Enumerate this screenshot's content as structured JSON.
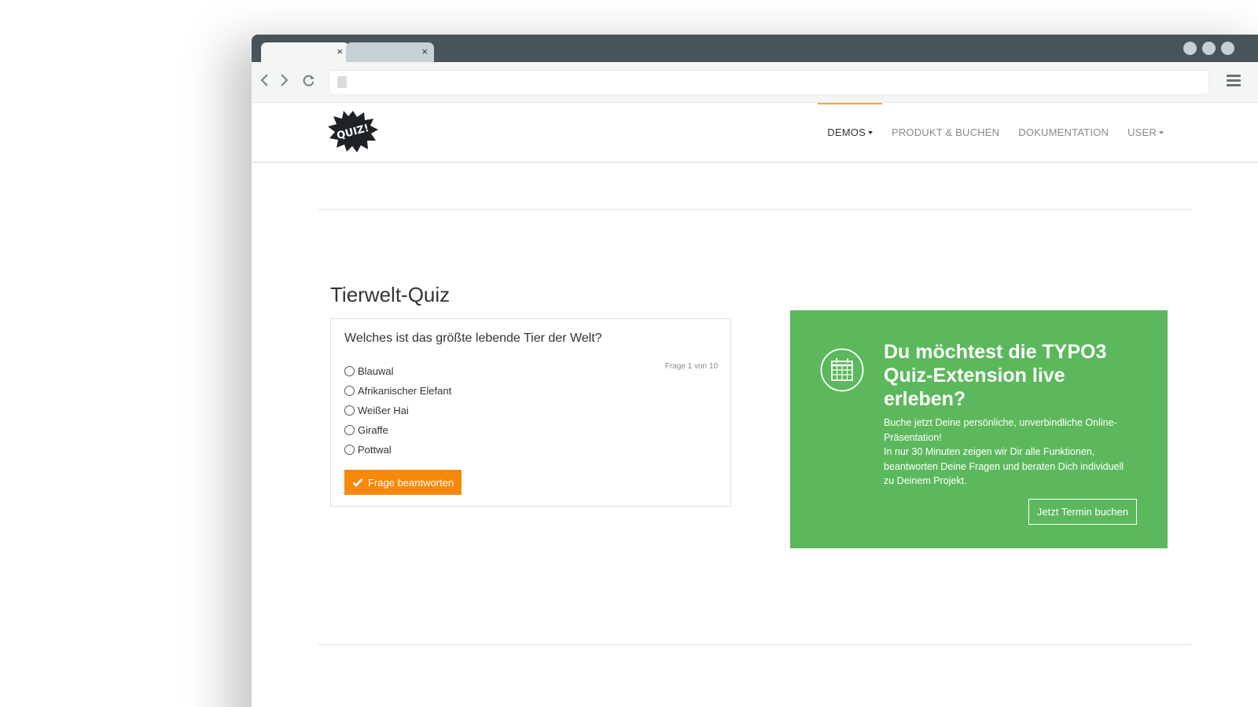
{
  "browser": {
    "tabs": [
      {
        "close": "×"
      },
      {
        "close": "×"
      }
    ]
  },
  "nav": {
    "items": [
      {
        "label": "DEMOS"
      },
      {
        "label": "PRODUKT & BUCHEN"
      },
      {
        "label": "DOKUMENTATION"
      },
      {
        "label": "USER"
      }
    ]
  },
  "logo": {
    "text": "QUIZ!"
  },
  "quiz": {
    "title": "Tierwelt-Quiz",
    "question": "Welches ist das größte lebende Tier der Welt?",
    "counter": "Frage 1 von 10",
    "answers": [
      "Blauwal",
      "Afrikanischer Elefant",
      "Weißer Hai",
      "Giraffe",
      "Pottwal"
    ],
    "submit_label": "Frage beantworten"
  },
  "promo": {
    "heading": "Du möchtest die TYPO3 Quiz-Extension live erleben?",
    "text_line1": "Buche jetzt Deine persönliche, unverbindliche Online-Präsentation!",
    "text_line2": "In nur 30 Minuten zeigen wir Dir alle Funktionen, beantworten Deine Fragen und beraten Dich individuell zu Deinem Projekt.",
    "button_label": "Jetzt Termin buchen"
  },
  "colors": {
    "accent_orange": "#f7890a",
    "promo_green": "#5cb85c",
    "tabbar": "#48545a",
    "nav_active_line": "#f1a24c"
  }
}
